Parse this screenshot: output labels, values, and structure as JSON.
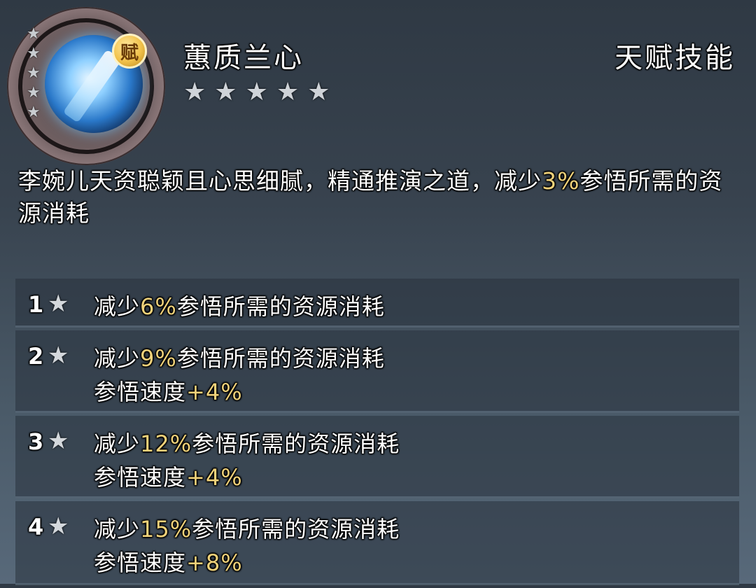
{
  "skill": {
    "name": "蕙质兰心",
    "type": "天赋技能",
    "badge": "赋",
    "rating_stars": 5,
    "icon_stars": 5,
    "star_glyph": "★"
  },
  "description": {
    "prefix": "李婉儿天资聪颖且心思细腻，精通推演之道，减少",
    "value": "3%",
    "suffix": "参悟所需的资源消耗"
  },
  "levels": [
    {
      "num": "1",
      "lines": [
        {
          "pre": "减少",
          "val": "6%",
          "post": "参悟所需的资源消耗"
        }
      ]
    },
    {
      "num": "2",
      "lines": [
        {
          "pre": "减少",
          "val": "9%",
          "post": "参悟所需的资源消耗"
        },
        {
          "pre": "参悟速度",
          "val": "+4%",
          "post": ""
        }
      ]
    },
    {
      "num": "3",
      "lines": [
        {
          "pre": "减少",
          "val": "12%",
          "post": "参悟所需的资源消耗"
        },
        {
          "pre": "参悟速度",
          "val": "+4%",
          "post": ""
        }
      ]
    },
    {
      "num": "4",
      "lines": [
        {
          "pre": "减少",
          "val": "15%",
          "post": "参悟所需的资源消耗"
        },
        {
          "pre": "参悟速度",
          "val": "+8%",
          "post": ""
        }
      ]
    }
  ],
  "colors": {
    "highlight": "#f0d27a",
    "text": "#ffffff",
    "star": "#cfd3d8"
  }
}
